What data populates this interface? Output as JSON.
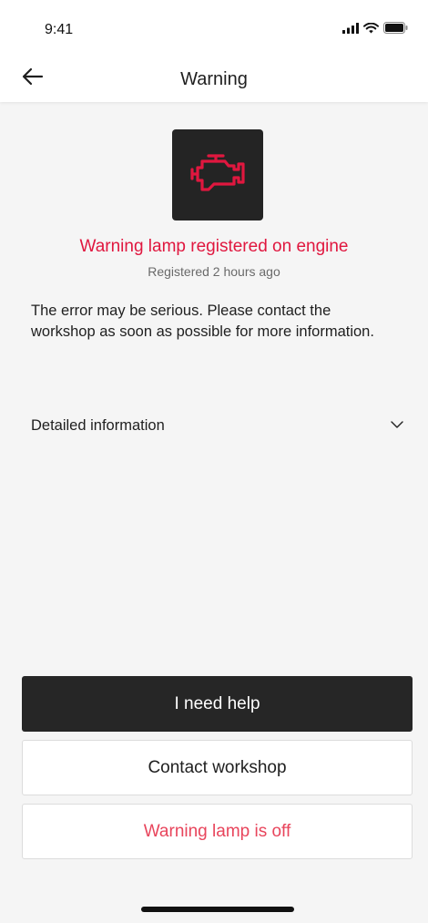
{
  "status_bar": {
    "time": "9:41",
    "icons": [
      "signal-icon",
      "wifi-icon",
      "battery-icon"
    ]
  },
  "nav": {
    "back_icon": "arrow-left-icon",
    "title": "Warning"
  },
  "warning": {
    "icon": "engine-icon",
    "icon_color": "#e0173f",
    "headline": "Warning lamp registered on engine",
    "registered": "Registered 2 hours ago",
    "message": "The error may be serious. Please contact the workshop as soon as possible for more information."
  },
  "details": {
    "label": "Detailed information",
    "icon": "chevron-down-icon",
    "expanded": false
  },
  "actions": {
    "help_label": "I need help",
    "contact_label": "Contact workshop",
    "lamp_off_label": "Warning lamp is off"
  },
  "colors": {
    "accent_red": "#e0173f",
    "danger_text": "#e8455c",
    "dark_button": "#262626",
    "background": "#f5f5f5"
  }
}
